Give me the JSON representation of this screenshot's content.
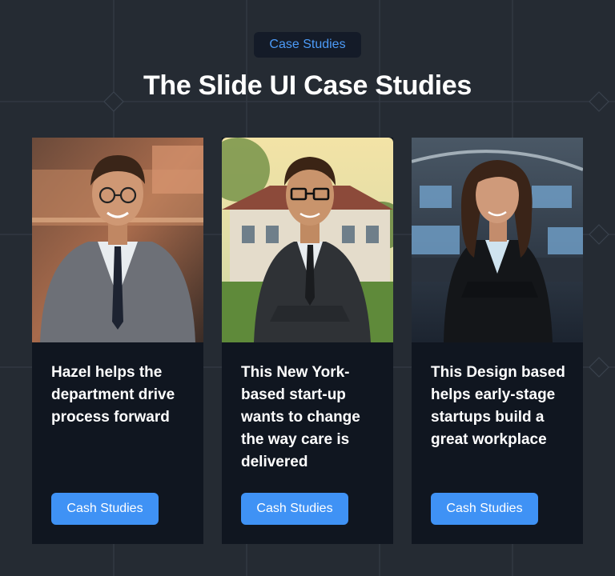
{
  "header": {
    "badge_label": "Case Studies",
    "title": "The Slide UI Case Studies"
  },
  "cards": [
    {
      "description": "Hazel helps the department drive process forward",
      "button_label": "Cash Studies",
      "photo": "man-in-grey-suit-office-photo"
    },
    {
      "description": "This New York-based start-up wants to change the way care is delivered",
      "button_label": "Cash Studies",
      "photo": "man-with-glasses-arms-crossed-outdoor-photo"
    },
    {
      "description": "This Design based helps early-stage startups build a great workplace",
      "button_label": "Cash Studies",
      "photo": "woman-in-black-blazer-control-room-photo"
    }
  ],
  "colors": {
    "background": "#252b33",
    "card": "#101620",
    "accent": "#3f92f5",
    "badge_text": "#4c9bf8"
  }
}
